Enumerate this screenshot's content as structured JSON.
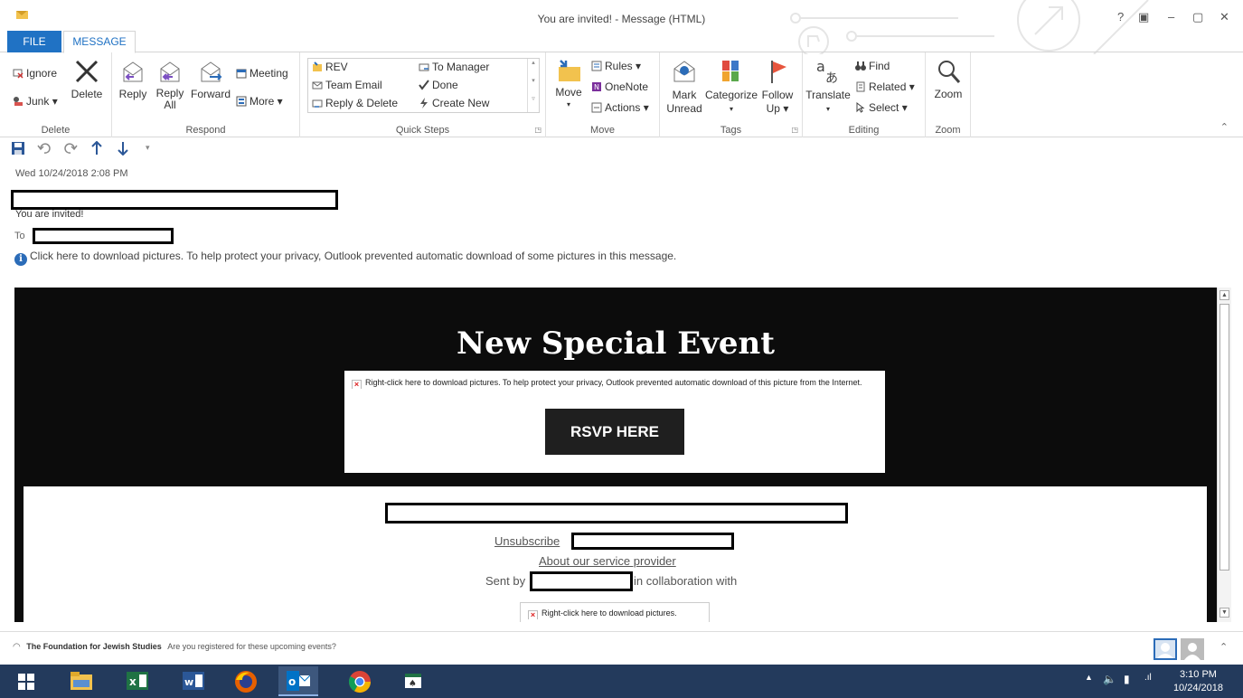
{
  "window": {
    "title": "You are invited! - Message (HTML)",
    "help": "?",
    "restore_ribbon": "▣",
    "minimize": "–",
    "maximize": "▢",
    "close": "✕"
  },
  "tabs": [
    {
      "label": "FILE"
    },
    {
      "label": "MESSAGE"
    }
  ],
  "ribbon": {
    "delete_group": {
      "label": "Delete",
      "ignore": "Ignore",
      "junk": "Junk",
      "delete": "Delete"
    },
    "respond_group": {
      "label": "Respond",
      "reply": "Reply",
      "reply_all_1": "Reply",
      "reply_all_2": "All",
      "forward": "Forward",
      "meeting": "Meeting",
      "more": "More"
    },
    "quick_steps_group": {
      "label": "Quick Steps",
      "items": [
        "REV",
        "To Manager",
        "Team Email",
        "Done",
        "Reply & Delete",
        "Create New"
      ]
    },
    "move_group": {
      "label": "Move",
      "move": "Move",
      "rules": "Rules",
      "onenote": "OneNote",
      "actions": "Actions"
    },
    "tags_group": {
      "label": "Tags",
      "mark_unread_1": "Mark",
      "mark_unread_2": "Unread",
      "categorize": "Categorize",
      "follow_up_1": "Follow",
      "follow_up_2": "Up"
    },
    "editing_group": {
      "label": "Editing",
      "translate": "Translate",
      "find": "Find",
      "related": "Related",
      "select": "Select"
    },
    "zoom_group": {
      "label": "Zoom",
      "zoom": "Zoom"
    }
  },
  "message": {
    "date": "Wed 10/24/2018 2:08 PM",
    "subject": "You are invited!",
    "to_label": "To",
    "info_bar": "Click here to download pictures. To help protect your privacy, Outlook prevented automatic download of some pictures in this message."
  },
  "email": {
    "title": "New Special Event",
    "blocked_image_text": "Right-click here to download pictures.  To help protect your privacy, Outlook prevented automatic download of this picture from the Internet.",
    "rsvp_label": "RSVP HERE",
    "unsubscribe": "Unsubscribe",
    "about_provider": "About our service provider",
    "sent_by": "Sent by",
    "collaboration": "in collaboration with",
    "small_blocked_text": "Right-click here to download pictures."
  },
  "people_pane": {
    "sender": "The Foundation for Jewish Studies",
    "snippet": "Are you registered for these upcoming events?"
  },
  "taskbar": {
    "time": "3:10 PM",
    "date": "10/24/2018"
  },
  "colors": {
    "accent": "#2072c4",
    "email_bg": "#0c0c0c",
    "taskbar": "#233a5c"
  }
}
